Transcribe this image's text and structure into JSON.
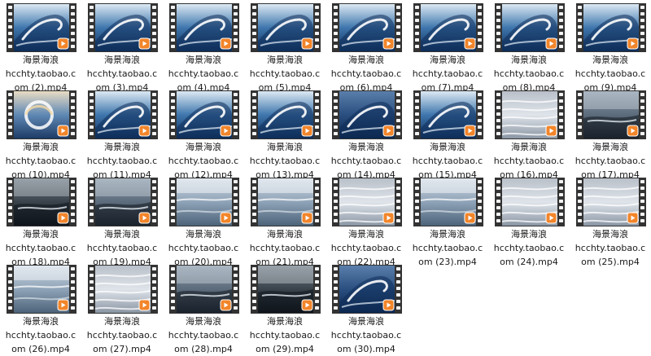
{
  "title_text": "海景海浪",
  "icons": {
    "film_frame": "film-strip-icon",
    "play_badge": "play-icon"
  },
  "colors": {
    "badge": "#f2852a",
    "film": "#333333",
    "sprocket": "#f4f4f4"
  },
  "files": [
    {
      "title": "海景海浪",
      "line1": "hcchty.taobao.c",
      "line2": "om (2).mp4",
      "scene": "curl"
    },
    {
      "title": "海景海浪",
      "line1": "hcchty.taobao.c",
      "line2": "om (3).mp4",
      "scene": "curl"
    },
    {
      "title": "海景海浪",
      "line1": "hcchty.taobao.c",
      "line2": "om (4).mp4",
      "scene": "curl"
    },
    {
      "title": "海景海浪",
      "line1": "hcchty.taobao.c",
      "line2": "om (5).mp4",
      "scene": "curl"
    },
    {
      "title": "海景海浪",
      "line1": "hcchty.taobao.c",
      "line2": "om (6).mp4",
      "scene": "curl"
    },
    {
      "title": "海景海浪",
      "line1": "hcchty.taobao.c",
      "line2": "om (7).mp4",
      "scene": "curl"
    },
    {
      "title": "海景海浪",
      "line1": "hcchty.taobao.c",
      "line2": "om (8).mp4",
      "scene": "curl"
    },
    {
      "title": "海景海浪",
      "line1": "hcchty.taobao.c",
      "line2": "om (9).mp4",
      "scene": "curl"
    },
    {
      "title": "海景海浪",
      "line1": "hcchty.taobao.c",
      "line2": "om (10).mp4",
      "scene": "swirl"
    },
    {
      "title": "海景海浪",
      "line1": "hcchty.taobao.c",
      "line2": "om (11).mp4",
      "scene": "curl"
    },
    {
      "title": "海景海浪",
      "line1": "hcchty.taobao.c",
      "line2": "om (12).mp4",
      "scene": "curl"
    },
    {
      "title": "海景海浪",
      "line1": "hcchty.taobao.c",
      "line2": "om (13).mp4",
      "scene": "curl"
    },
    {
      "title": "海景海浪",
      "line1": "hcchty.taobao.c",
      "line2": "om (14).mp4",
      "scene": "deep"
    },
    {
      "title": "海景海浪",
      "line1": "hcchty.taobao.c",
      "line2": "om (15).mp4",
      "scene": "curl"
    },
    {
      "title": "海景海浪",
      "line1": "hcchty.taobao.c",
      "line2": "om (16).mp4",
      "scene": "foam"
    },
    {
      "title": "海景海浪",
      "line1": "hcchty.taobao.c",
      "line2": "om (17).mp4",
      "scene": "storm"
    },
    {
      "title": "海景海浪",
      "line1": "hcchty.taobao.c",
      "line2": "om (18).mp4",
      "scene": "dark"
    },
    {
      "title": "海景海浪",
      "line1": "hcchty.taobao.c",
      "line2": "om (19).mp4",
      "scene": "storm"
    },
    {
      "title": "海景海浪",
      "line1": "hcchty.taobao.c",
      "line2": "om (20).mp4",
      "scene": "sea"
    },
    {
      "title": "海景海浪",
      "line1": "hcchty.taobao.c",
      "line2": "om (21).mp4",
      "scene": "sea"
    },
    {
      "title": "海景海浪",
      "line1": "hcchty.taobao.c",
      "line2": "om (22).mp4",
      "scene": "foam"
    },
    {
      "title": "海景海浪",
      "line1": "hcchty.taobao.c",
      "line2": "om (23).mp4",
      "scene": "sea"
    },
    {
      "title": "海景海浪",
      "line1": "hcchty.taobao.c",
      "line2": "om (24).mp4",
      "scene": "foam"
    },
    {
      "title": "海景海浪",
      "line1": "hcchty.taobao.c",
      "line2": "om (25).mp4",
      "scene": "foam"
    },
    {
      "title": "海景海浪",
      "line1": "hcchty.taobao.c",
      "line2": "om (26).mp4",
      "scene": "sea"
    },
    {
      "title": "海景海浪",
      "line1": "hcchty.taobao.c",
      "line2": "om (27).mp4",
      "scene": "foam"
    },
    {
      "title": "海景海浪",
      "line1": "hcchty.taobao.c",
      "line2": "om (28).mp4",
      "scene": "storm"
    },
    {
      "title": "海景海浪",
      "line1": "hcchty.taobao.c",
      "line2": "om (29).mp4",
      "scene": "dark"
    },
    {
      "title": "海景海浪",
      "line1": "hcchty.taobao.c",
      "line2": "om (30).mp4",
      "scene": "deep"
    }
  ]
}
